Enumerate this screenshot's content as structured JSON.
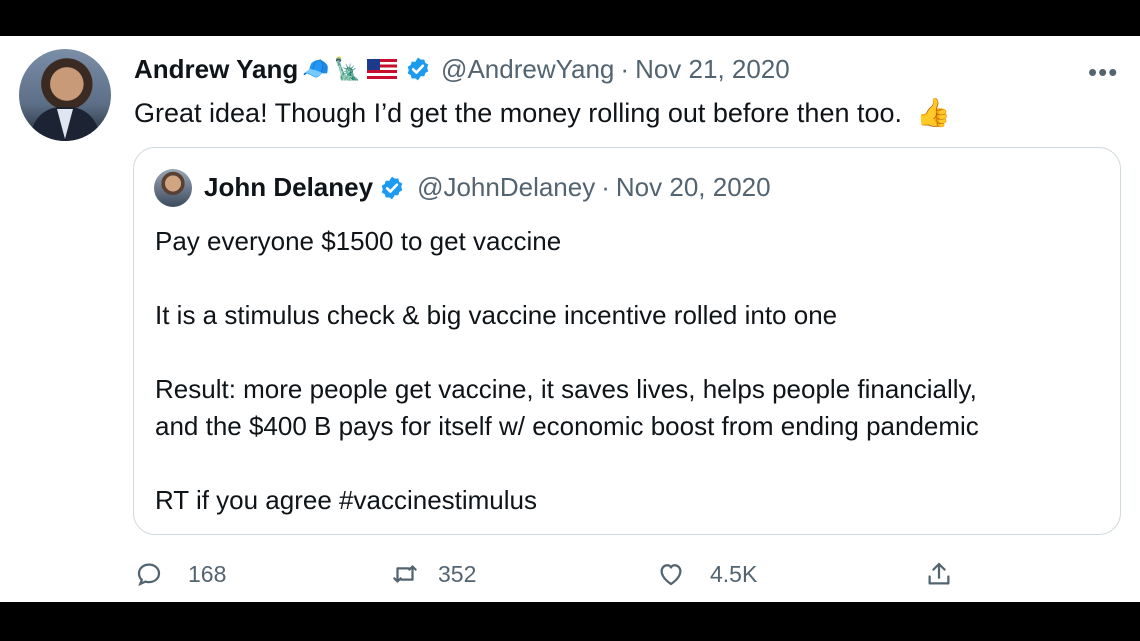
{
  "tweet": {
    "author_name": "Andrew Yang",
    "author_emojis": [
      "🧢",
      "🗽",
      "🇺🇸"
    ],
    "handle": "@AndrewYang",
    "separator": "·",
    "date": "Nov 21, 2020",
    "more_label": "•••",
    "text": "Great idea!  Though I’d get the money rolling out before then too.",
    "text_emoji": "👍"
  },
  "quoted_tweet": {
    "author_name": "John Delaney",
    "handle": "@JohnDelaney",
    "separator": "·",
    "date": "Nov 20, 2020",
    "lines": [
      "Pay everyone $1500 to get vaccine",
      "It is a stimulus check & big vaccine incentive rolled into one",
      "Result: more people get vaccine, it saves lives, helps people financially,",
      "and the $400 B pays for itself w/ economic boost from ending pandemic",
      "RT if you agree #vaccinestimulus"
    ]
  },
  "actions": {
    "replies": "168",
    "retweets": "352",
    "likes": "4.5K"
  },
  "colors": {
    "verified": "#1d9bf0",
    "muted_text": "#536471",
    "text": "#0f1419",
    "border": "#cfd9de"
  }
}
